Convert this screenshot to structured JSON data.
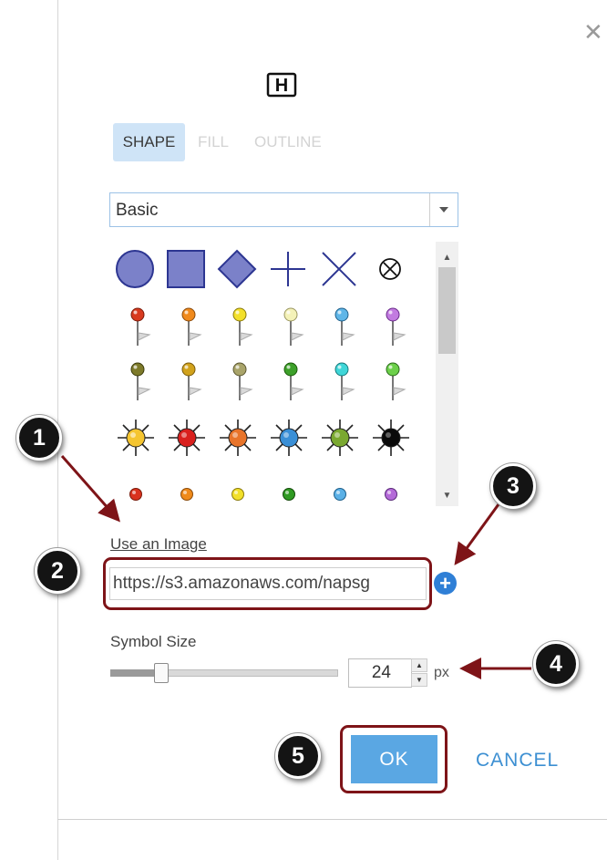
{
  "dialog": {
    "close_glyph": "✕",
    "preview_letter": "H",
    "tabs": [
      {
        "label": "SHAPE",
        "active": true
      },
      {
        "label": "FILL",
        "active": false
      },
      {
        "label": "OUTLINE",
        "active": false
      }
    ],
    "category": {
      "selected": "Basic"
    },
    "symbol_rows": [
      [
        "circle",
        "square",
        "diamond",
        "plus",
        "x",
        "circle-x"
      ],
      [
        "red-pushpin",
        "orange-pushpin",
        "yellow-pushpin",
        "light-yellow-pushpin",
        "blue-pushpin",
        "purple-pushpin"
      ],
      [
        "olive-pushpin",
        "gold-pushpin",
        "khaki-pushpin",
        "green-pushpin",
        "cyan-pushpin",
        "lime-pushpin"
      ],
      [
        "yellow-sun",
        "red-sun",
        "orange-sun",
        "blue-sun",
        "green-sun",
        "black-sun"
      ],
      [
        "red-dot",
        "orange-dot",
        "yellow-dot",
        "green-dot",
        "blue-dot",
        "purple-dot"
      ]
    ],
    "image": {
      "label": "Use an Image",
      "url_value": "https://s3.amazonaws.com/napsg",
      "add_glyph": "+"
    },
    "size": {
      "label": "Symbol Size",
      "value": "24",
      "unit": "px",
      "slider_fraction": 0.22
    },
    "buttons": {
      "ok": "OK",
      "cancel": "CANCEL"
    }
  },
  "callouts": [
    "1",
    "2",
    "3",
    "4",
    "5"
  ],
  "colors": {
    "accent": "#5aa7e3",
    "highlight_border": "#7e1418",
    "shape_fill": "#7b81c9",
    "shape_stroke": "#2d3692",
    "cancel_text": "#3c8fd2"
  }
}
